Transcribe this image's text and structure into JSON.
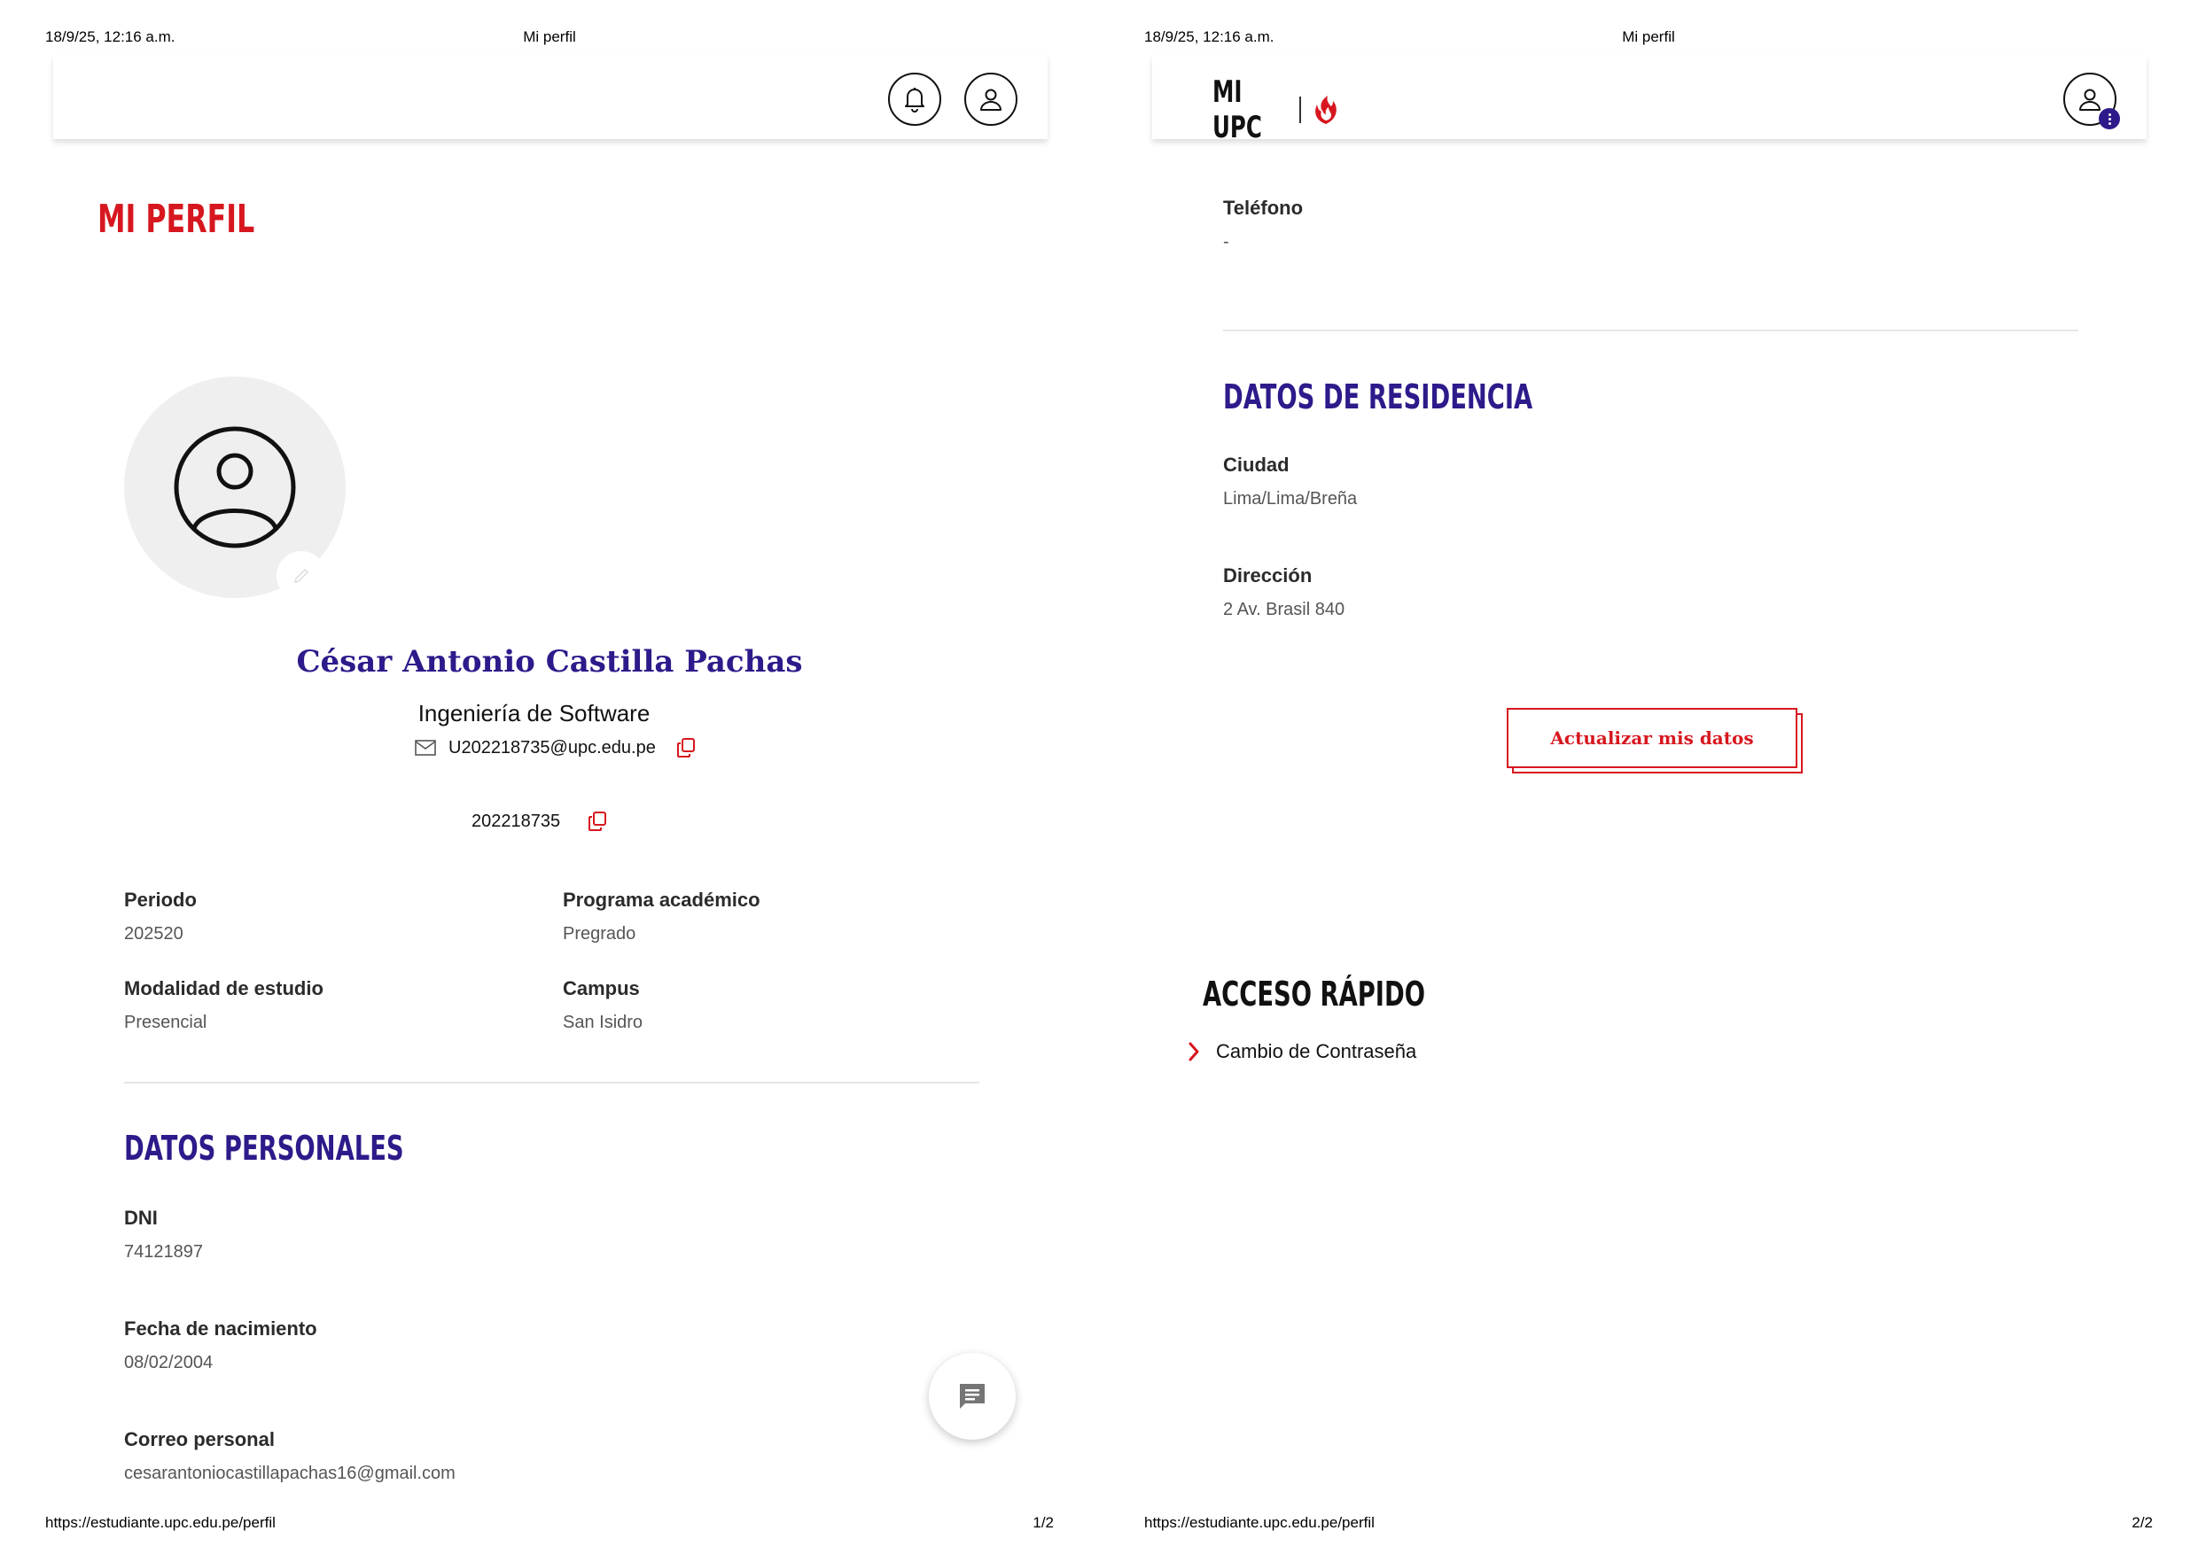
{
  "print": {
    "date": "18/9/25, 12:16 a.m.",
    "title": "Mi perfil",
    "url": "https://estudiante.upc.edu.pe/perfil",
    "page1": "1/2",
    "page2": "2/2"
  },
  "brand": {
    "name": "MI UPC"
  },
  "profile": {
    "title": "MI PERFIL",
    "name": "César Antonio Castilla Pachas",
    "career": "Ingeniería de Software",
    "email": "U202218735@upc.edu.pe",
    "code": "202218735"
  },
  "academic": {
    "periodo_label": "Periodo",
    "periodo_value": "202520",
    "programa_label": "Programa académico",
    "programa_value": "Pregrado",
    "modalidad_label": "Modalidad de estudio",
    "modalidad_value": "Presencial",
    "campus_label": "Campus",
    "campus_value": "San Isidro"
  },
  "personal": {
    "title": "DATOS PERSONALES",
    "dni_label": "DNI",
    "dni_value": "74121897",
    "nacimiento_label": "Fecha de nacimiento",
    "nacimiento_value": "08/02/2004",
    "correo_label": "Correo personal",
    "correo_value": "cesarantoniocastillapachas16@gmail.com",
    "telefono_label": "Teléfono",
    "telefono_value": "-"
  },
  "residence": {
    "title": "DATOS DE RESIDENCIA",
    "ciudad_label": "Ciudad",
    "ciudad_value": "Lima/Lima/Breña",
    "direccion_label": "Dirección",
    "direccion_value": "2 Av. Brasil 840"
  },
  "actions": {
    "update_label": "Actualizar mis datos"
  },
  "quick_access": {
    "title": "ACCESO RÁPIDO",
    "items": [
      {
        "label": "Cambio de Contraseña"
      }
    ]
  },
  "colors": {
    "brand_red": "#d7171f",
    "brand_purple": "#2e1a8a"
  },
  "icons": [
    "bell-icon",
    "user-icon",
    "more-icon",
    "mail-icon",
    "copy-icon",
    "edit-icon",
    "chat-icon",
    "chevron-right-icon",
    "upc-flame-logo"
  ]
}
